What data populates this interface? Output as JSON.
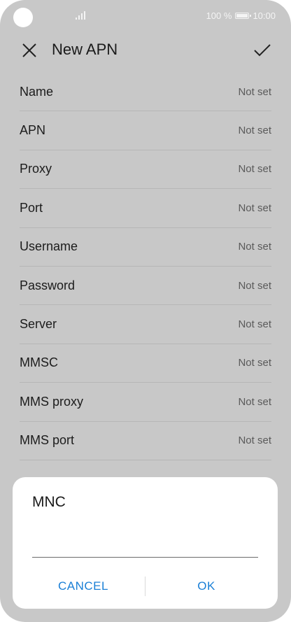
{
  "status_bar": {
    "battery_text": "100 %",
    "time": "10:00",
    "icons": [
      "camera-cutout",
      "signal-icon",
      "battery-icon"
    ]
  },
  "app_bar": {
    "title": "New APN",
    "icons": {
      "left": "close-icon",
      "right": "check-icon"
    }
  },
  "fields": [
    {
      "label": "Name",
      "value": "Not set"
    },
    {
      "label": "APN",
      "value": "Not set"
    },
    {
      "label": "Proxy",
      "value": "Not set"
    },
    {
      "label": "Port",
      "value": "Not set"
    },
    {
      "label": "Username",
      "value": "Not set"
    },
    {
      "label": "Password",
      "value": "Not set"
    },
    {
      "label": "Server",
      "value": "Not set"
    },
    {
      "label": "MMSC",
      "value": "Not set"
    },
    {
      "label": "MMS proxy",
      "value": "Not set"
    },
    {
      "label": "MMS port",
      "value": "Not set"
    }
  ],
  "dialog": {
    "title": "MNC",
    "input_value": "",
    "cancel_label": "CANCEL",
    "ok_label": "OK"
  },
  "colors": {
    "scrim": "#c8c8c8",
    "accent": "#1a7fd6",
    "dialog_bg": "#ffffff"
  }
}
